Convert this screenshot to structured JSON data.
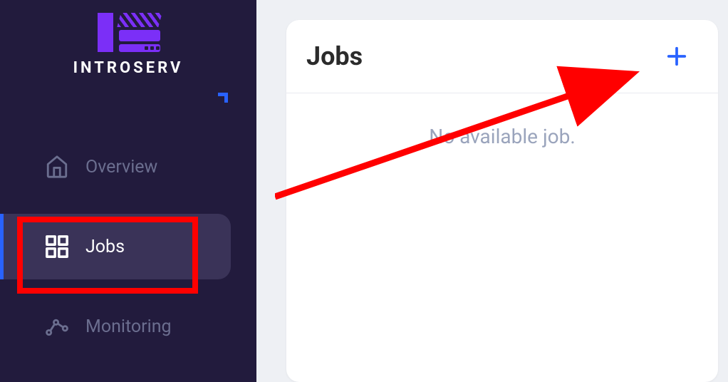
{
  "brand": {
    "name": "INTROSERV"
  },
  "sidebar": {
    "items": [
      {
        "label": "Overview",
        "icon": "home-icon",
        "active": false
      },
      {
        "label": "Jobs",
        "icon": "grid-icon",
        "active": true
      },
      {
        "label": "Monitoring",
        "icon": "analytics-icon",
        "active": false
      }
    ]
  },
  "main": {
    "card": {
      "title": "Jobs",
      "empty_message": "No available job."
    }
  },
  "annotations": {
    "highlight_target": "sidebar-item-jobs",
    "arrow_target": "add-job-button"
  }
}
